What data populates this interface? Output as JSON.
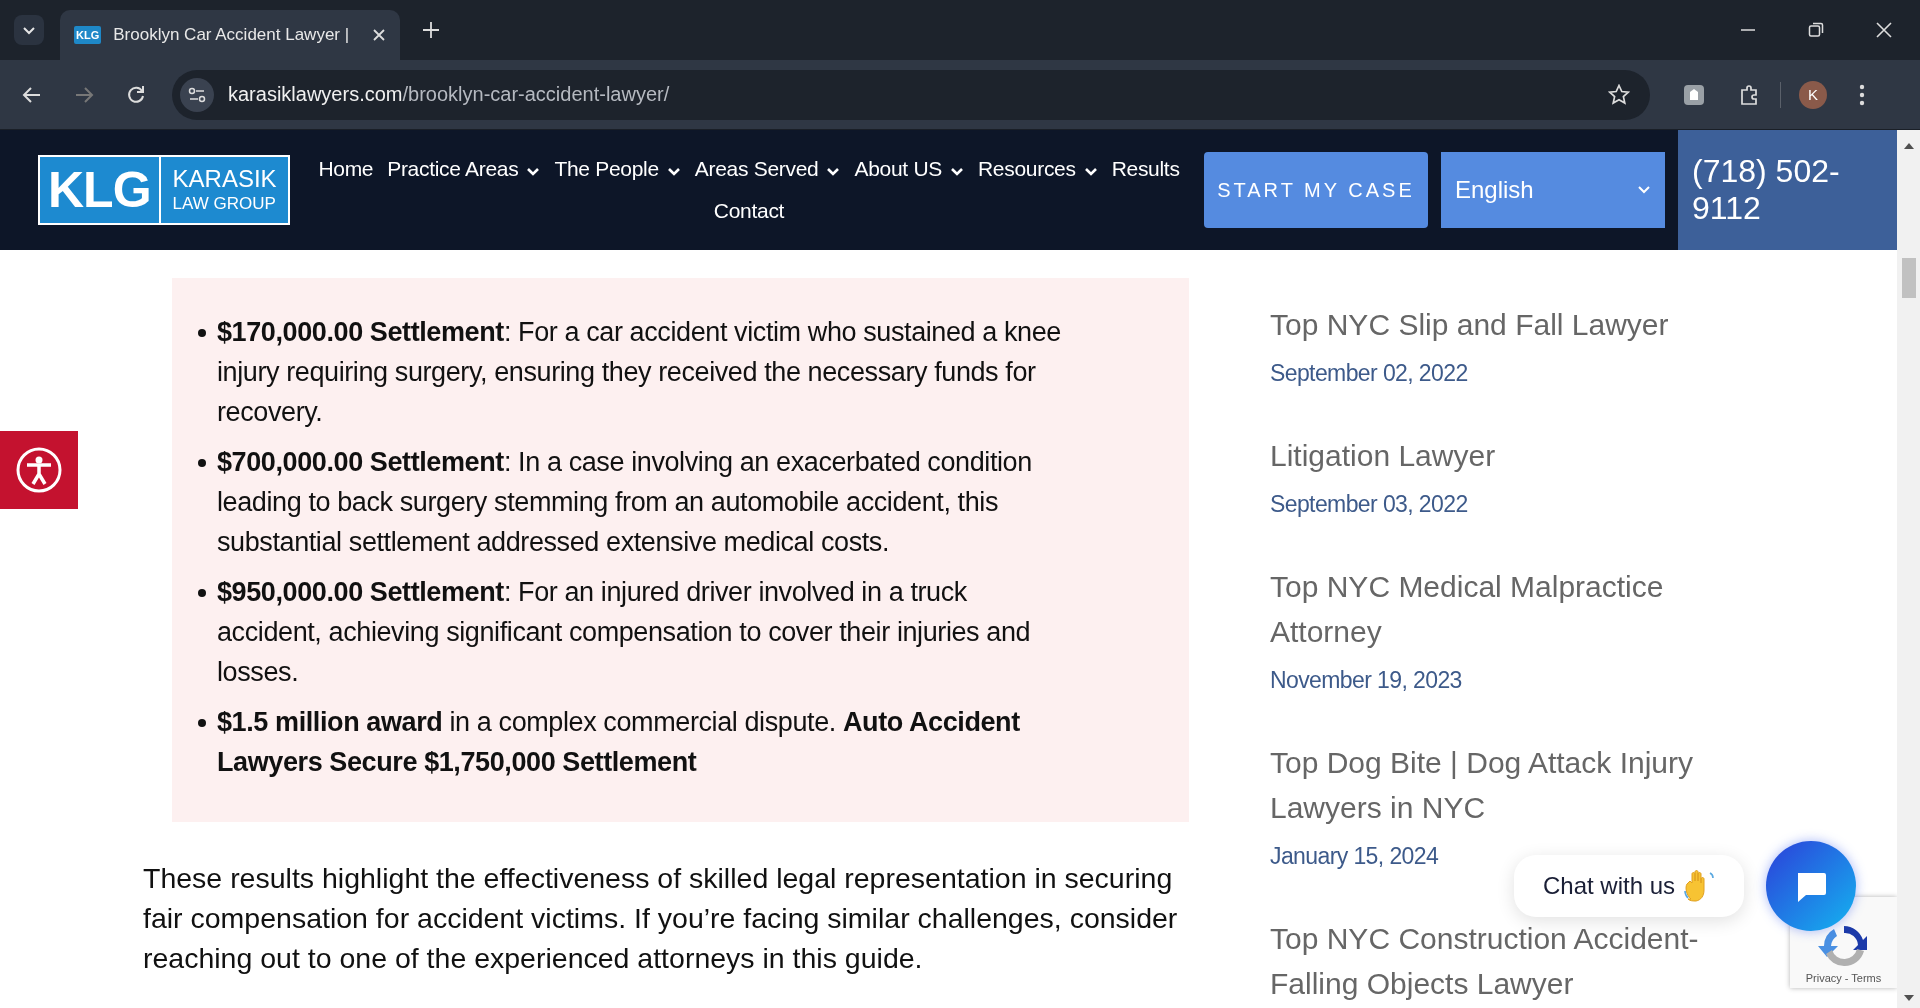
{
  "browser": {
    "tab_title": "Brooklyn Car Accident Lawyer |",
    "favicon": "KLG",
    "url_domain": "karasiklawyers.com",
    "url_path": "/brooklyn-car-accident-lawyer/",
    "profile": "K"
  },
  "header": {
    "logo": {
      "mark": "KLG",
      "name": "KARASIK",
      "sub": "LAW GROUP"
    },
    "nav": [
      {
        "label": "Home",
        "dropdown": false
      },
      {
        "label": "Practice Areas",
        "dropdown": true
      },
      {
        "label": "The People",
        "dropdown": true
      },
      {
        "label": "Areas Served",
        "dropdown": true
      },
      {
        "label": "About US",
        "dropdown": true
      },
      {
        "label": "Resources",
        "dropdown": true
      },
      {
        "label": "Results",
        "dropdown": false
      },
      {
        "label": "Contact",
        "dropdown": false
      }
    ],
    "cta": "START MY CASE",
    "language": "English",
    "phone": "(718) 502-9112"
  },
  "results": [
    "**$170,000.00 Settlement**: For a car accident victim who sustained a knee injury requiring surgery, ensuring they received the necessary funds for recovery.",
    "**$700,000.00 Settlement**: In a case involving an exacerbated condition leading to back surgery stemming from an automobile accident, this substantial settlement addressed extensive medical costs.",
    "**$950,000.00 Settlement**: For an injured driver involved in a truck accident, achieving significant compensation to cover their injuries and losses.",
    "**$1.5 million award** in a complex commercial dispute. **Auto Accident Lawyers Secure $1,750,000 Settlement**"
  ],
  "paragraph": "These results highlight the effectiveness of skilled legal representation in securing fair compensation for accident victims. If you’re facing similar challenges, consider reaching out to one of the experienced attorneys in this guide.",
  "sidebar_posts": [
    {
      "title": "Top NYC Slip and Fall Lawyer",
      "date": "September 02, 2022"
    },
    {
      "title": "Litigation Lawyer",
      "date": "September 03, 2022"
    },
    {
      "title": "Top NYC Medical Malpractice Attorney",
      "date": "November 19, 2023"
    },
    {
      "title": "Top Dog Bite | Dog Attack Injury Lawyers in NYC",
      "date": "January 15, 2024"
    },
    {
      "title": "Top NYC Construction Accident-Falling Objects Lawyer"
    }
  ],
  "chat": {
    "label": "Chat with us"
  },
  "recaptcha": {
    "links": "Privacy - Terms"
  }
}
